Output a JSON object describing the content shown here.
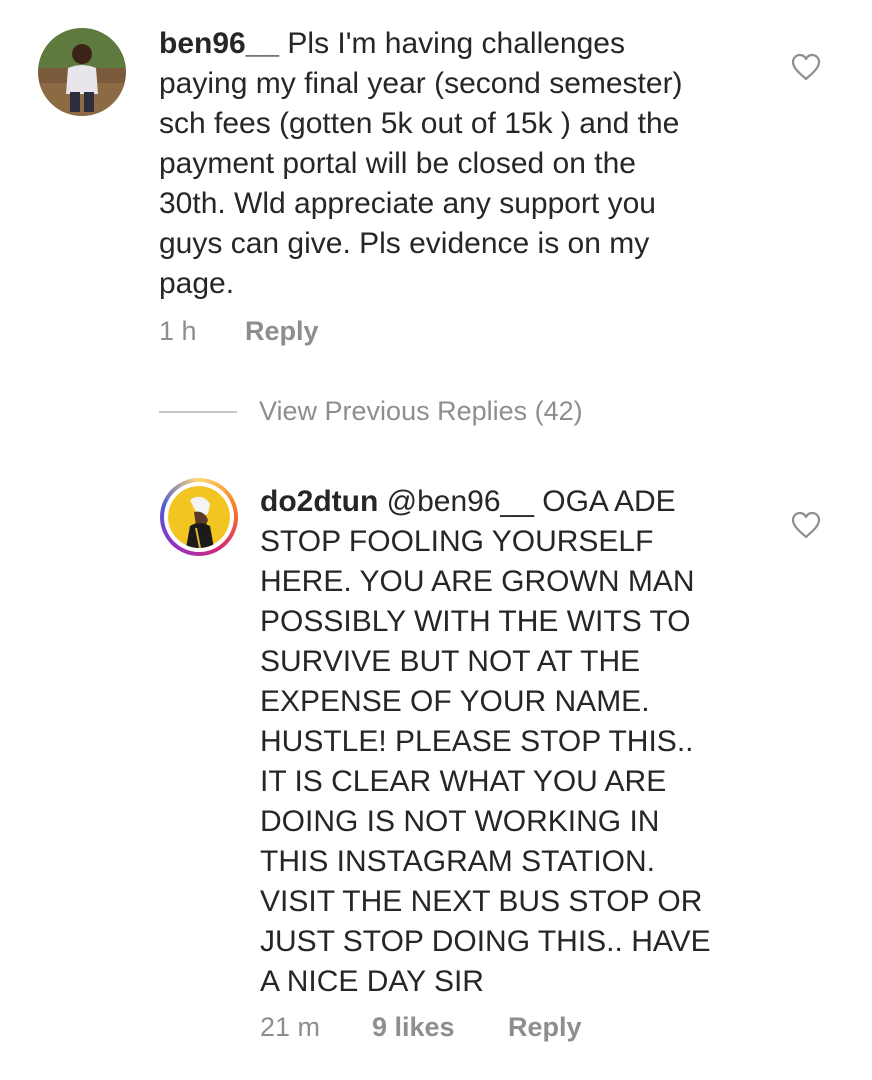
{
  "comment1": {
    "username": "ben96__",
    "text": " Pls I'm having challenges\npaying my final year (second semester)\nsch fees (gotten 5k out of 15k ) and the\npayment portal will be closed on the\n30th. Wld appreciate any support you\nguys can give. Pls evidence is on my\npage.",
    "time": "1 h",
    "reply_label": "Reply",
    "like_icon": "heart-outline-icon"
  },
  "view_previous": {
    "label": "View Previous Replies (42)"
  },
  "reply1": {
    "username": "do2dtun",
    "mention": " @ben96__",
    "text": " OGA ADE\nSTOP FOOLING YOURSELF\nHERE. YOU ARE GROWN MAN\nPOSSIBLY WITH THE WITS TO\nSURVIVE BUT NOT AT THE\nEXPENSE OF YOUR NAME.\nHUSTLE! PLEASE STOP THIS..\nIT IS CLEAR WHAT YOU ARE\nDOING IS NOT WORKING IN\nTHIS INSTAGRAM STATION.\nVISIT THE NEXT BUS STOP OR\nJUST STOP DOING THIS.. HAVE\nA NICE DAY SIR",
    "time": "21 m",
    "likes": "9 likes",
    "reply_label": "Reply",
    "like_icon": "heart-outline-icon"
  },
  "colors": {
    "text": "#262626",
    "secondary": "#8e8e8e",
    "story_ring": "#d6249f"
  }
}
